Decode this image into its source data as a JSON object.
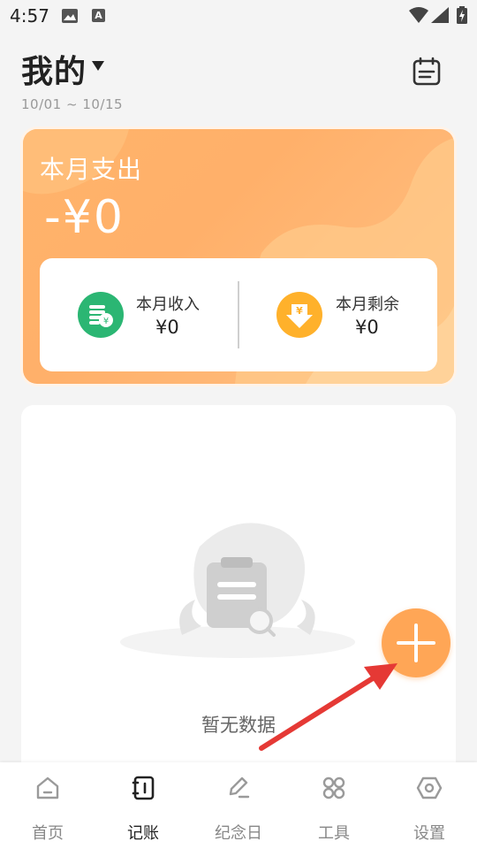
{
  "status_bar": {
    "time": "4:57",
    "a_badge": "A"
  },
  "header": {
    "title": "我的",
    "date_range": "10/01 ~ 10/15"
  },
  "summary": {
    "expense_label": "本月支出",
    "expense_value": "-¥0",
    "income_label": "本月收入",
    "income_value": "¥0",
    "remaining_label": "本月剩余",
    "remaining_value": "¥0",
    "remaining_icon_glyph": "¥"
  },
  "list": {
    "empty_text": "暂无数据"
  },
  "nav": {
    "items": [
      {
        "label": "首页",
        "icon": "home-icon",
        "active": false
      },
      {
        "label": "记账",
        "icon": "notebook-icon",
        "active": true
      },
      {
        "label": "纪念日",
        "icon": "edit-icon",
        "active": false
      },
      {
        "label": "工具",
        "icon": "grid-icon",
        "active": false
      },
      {
        "label": "设置",
        "icon": "settings-icon",
        "active": false
      }
    ]
  },
  "colors": {
    "card_orange": "#ffb36b",
    "income_green": "#2bb673",
    "remaining_yellow": "#ffb12b",
    "fab_orange": "#ffa656",
    "annotation_red": "#e53935"
  }
}
